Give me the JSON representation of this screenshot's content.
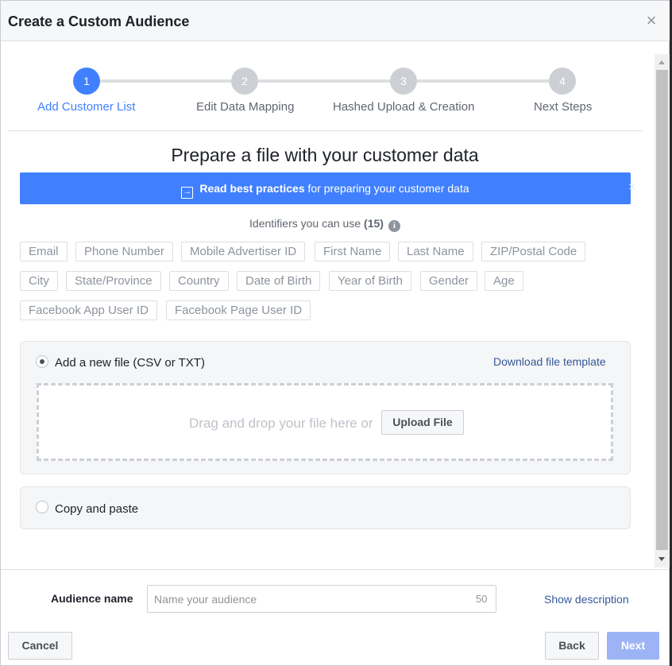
{
  "dialog": {
    "title": "Create a Custom Audience",
    "close_glyph": "×"
  },
  "stepper": {
    "steps": [
      {
        "number": "1",
        "label": "Add Customer List",
        "active": true
      },
      {
        "number": "2",
        "label": "Edit Data Mapping",
        "active": false
      },
      {
        "number": "3",
        "label": "Hashed Upload & Creation",
        "active": false
      },
      {
        "number": "4",
        "label": "Next Steps",
        "active": false
      }
    ]
  },
  "section": {
    "title": "Prepare a file with your customer data"
  },
  "banner": {
    "bold": "Read best practices",
    "rest": " for preparing your customer data",
    "icon": "sign-in-icon",
    "close_glyph": "×",
    "color": "#4080ff"
  },
  "identifiers": {
    "prefix": "Identifiers you can use ",
    "count": "(15)",
    "info_glyph": "i",
    "items": [
      "Email",
      "Phone Number",
      "Mobile Advertiser ID",
      "First Name",
      "Last Name",
      "ZIP/Postal Code",
      "City",
      "State/Province",
      "Country",
      "Date of Birth",
      "Year of Birth",
      "Gender",
      "Age",
      "Facebook App User ID",
      "Facebook Page User ID"
    ]
  },
  "upload_option": {
    "label": "Add a new file (CSV or TXT)",
    "template_link": "Download file template",
    "drop_text": "Drag and drop your file here or",
    "upload_button": "Upload File",
    "selected": true
  },
  "paste_option": {
    "label": "Copy and paste",
    "selected": false
  },
  "audience": {
    "label": "Audience name",
    "placeholder": "Name your audience",
    "value": "",
    "char_limit": "50",
    "show_description": "Show description"
  },
  "footer": {
    "cancel": "Cancel",
    "back": "Back",
    "next": "Next"
  }
}
